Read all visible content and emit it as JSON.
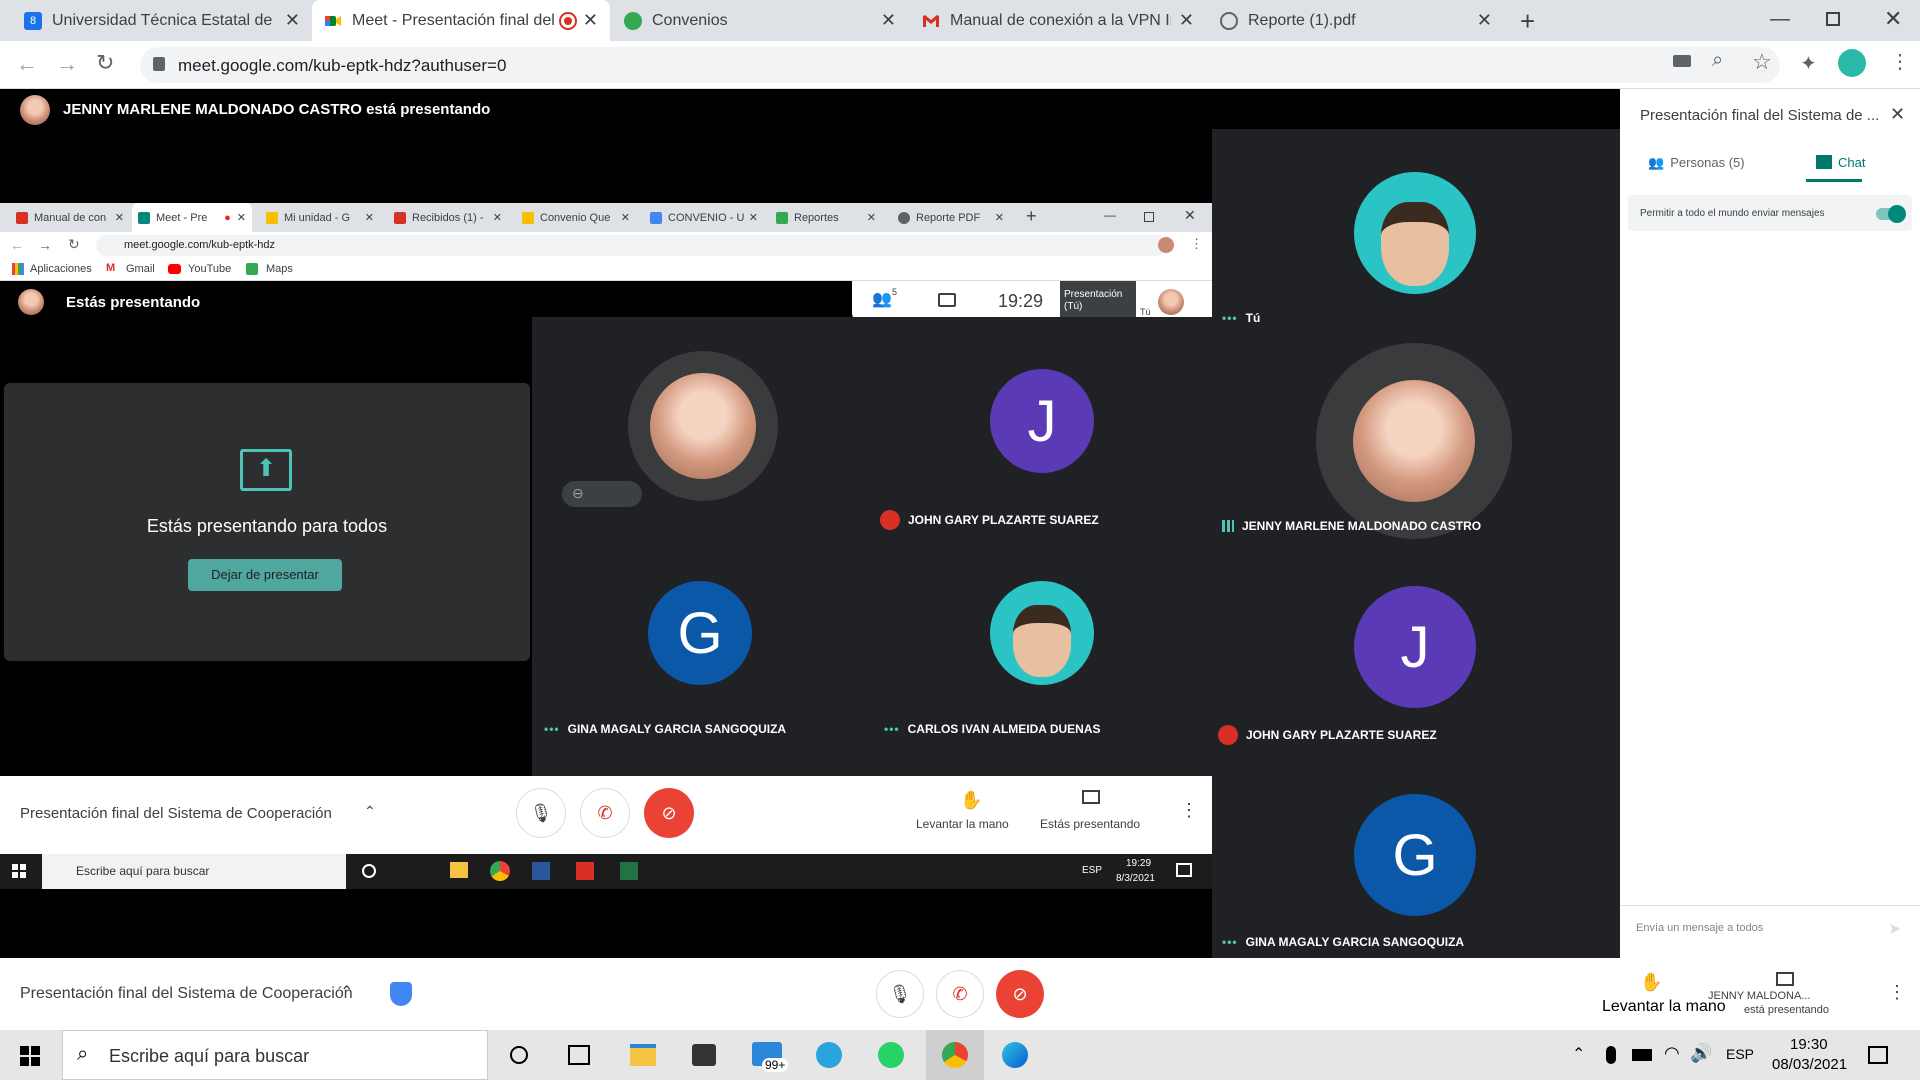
{
  "browser": {
    "tabs": [
      {
        "title": "Universidad Técnica Estatal de Qu",
        "icon": "utec-favicon"
      },
      {
        "title": "Meet - Presentación final del",
        "icon": "meet-favicon",
        "recording": true
      },
      {
        "title": "Convenios",
        "icon": "sheets-favicon"
      },
      {
        "title": "Manual de conexión a la VPN Ins",
        "icon": "gmail-favicon"
      },
      {
        "title": "Reporte (1).pdf",
        "icon": "globe-favicon"
      }
    ],
    "url": "meet.google.com/kub-eptk-hdz?authuser=0"
  },
  "meet": {
    "presenter_banner": "JENNY MARLENE MALDONADO CASTRO está presentando",
    "side_tiles": [
      {
        "name": "Tú",
        "type": "video"
      },
      {
        "name": "JENNY MARLENE MALDONADO CASTRO",
        "type": "photo"
      },
      {
        "name": "JOHN GARY PLAZARTE SUAREZ",
        "letter": "J",
        "color": "#5b3bb5",
        "muted": true
      },
      {
        "name": "GINA MAGALY GARCIA SANGOQUIZA",
        "letter": "G",
        "color": "#0b57a8"
      }
    ],
    "meeting_title": "Presentación final del Sistema de Cooperación",
    "raise_hand": "Levantar la mano",
    "presenting_label": "JENNY MALDONA...",
    "presenting_sub": "está presentando"
  },
  "panel": {
    "title": "Presentación final del Sistema de ...",
    "tab_people": "Personas (5)",
    "tab_chat": "Chat",
    "toggle_label": "Permitir a todo el mundo enviar mensajes",
    "message_placeholder": "Envía un mensaje a todos"
  },
  "inner": {
    "tabs": [
      {
        "title": "Manual de con",
        "color": "#d93025"
      },
      {
        "title": "Meet - Pre",
        "color": "#00897b"
      },
      {
        "title": "Mi unidad - G",
        "color": "#fbbc04"
      },
      {
        "title": "Recibidos (1) -",
        "color": "#d93025"
      },
      {
        "title": "Convenio Que",
        "color": "#fbbc04"
      },
      {
        "title": "CONVENIO - U",
        "color": "#4285f4"
      },
      {
        "title": "Reportes",
        "color": "#34a853"
      },
      {
        "title": "Reporte PDF",
        "color": "#5f6368"
      }
    ],
    "url": "meet.google.com/kub-eptk-hdz",
    "bookmarks": [
      "Aplicaciones",
      "Gmail",
      "YouTube",
      "Maps"
    ],
    "presenting_banner": "Estás presentando",
    "time": "19:29",
    "participants_count": "5",
    "presentation_chip": "Presentación (Tú)",
    "you_label": "Tú",
    "presenting_all": "Estás presentando para todos",
    "stop_button": "Dejar de presentar",
    "tiles": [
      {
        "name": "JOHN GARY PLAZARTE SUAREZ",
        "letter": "J",
        "color": "#5b3bb5"
      },
      {
        "name": "GINA MAGALY GARCIA SANGOQUIZA",
        "letter": "G",
        "color": "#0b57a8"
      },
      {
        "name": "CARLOS IVAN ALMEIDA DUENAS"
      }
    ],
    "meeting_title": "Presentación final del Sistema de Cooperación",
    "raise_hand": "Levantar la mano",
    "presenting": "Estás presentando",
    "search_placeholder": "Escribe aquí para buscar",
    "tray_lang": "ESP",
    "tray_time": "19:29",
    "tray_date": "8/3/2021"
  },
  "taskbar": {
    "search_placeholder": "Escribe aquí para buscar",
    "mail_badge": "99+",
    "lang": "ESP",
    "time": "19:30",
    "date": "08/03/2021"
  }
}
